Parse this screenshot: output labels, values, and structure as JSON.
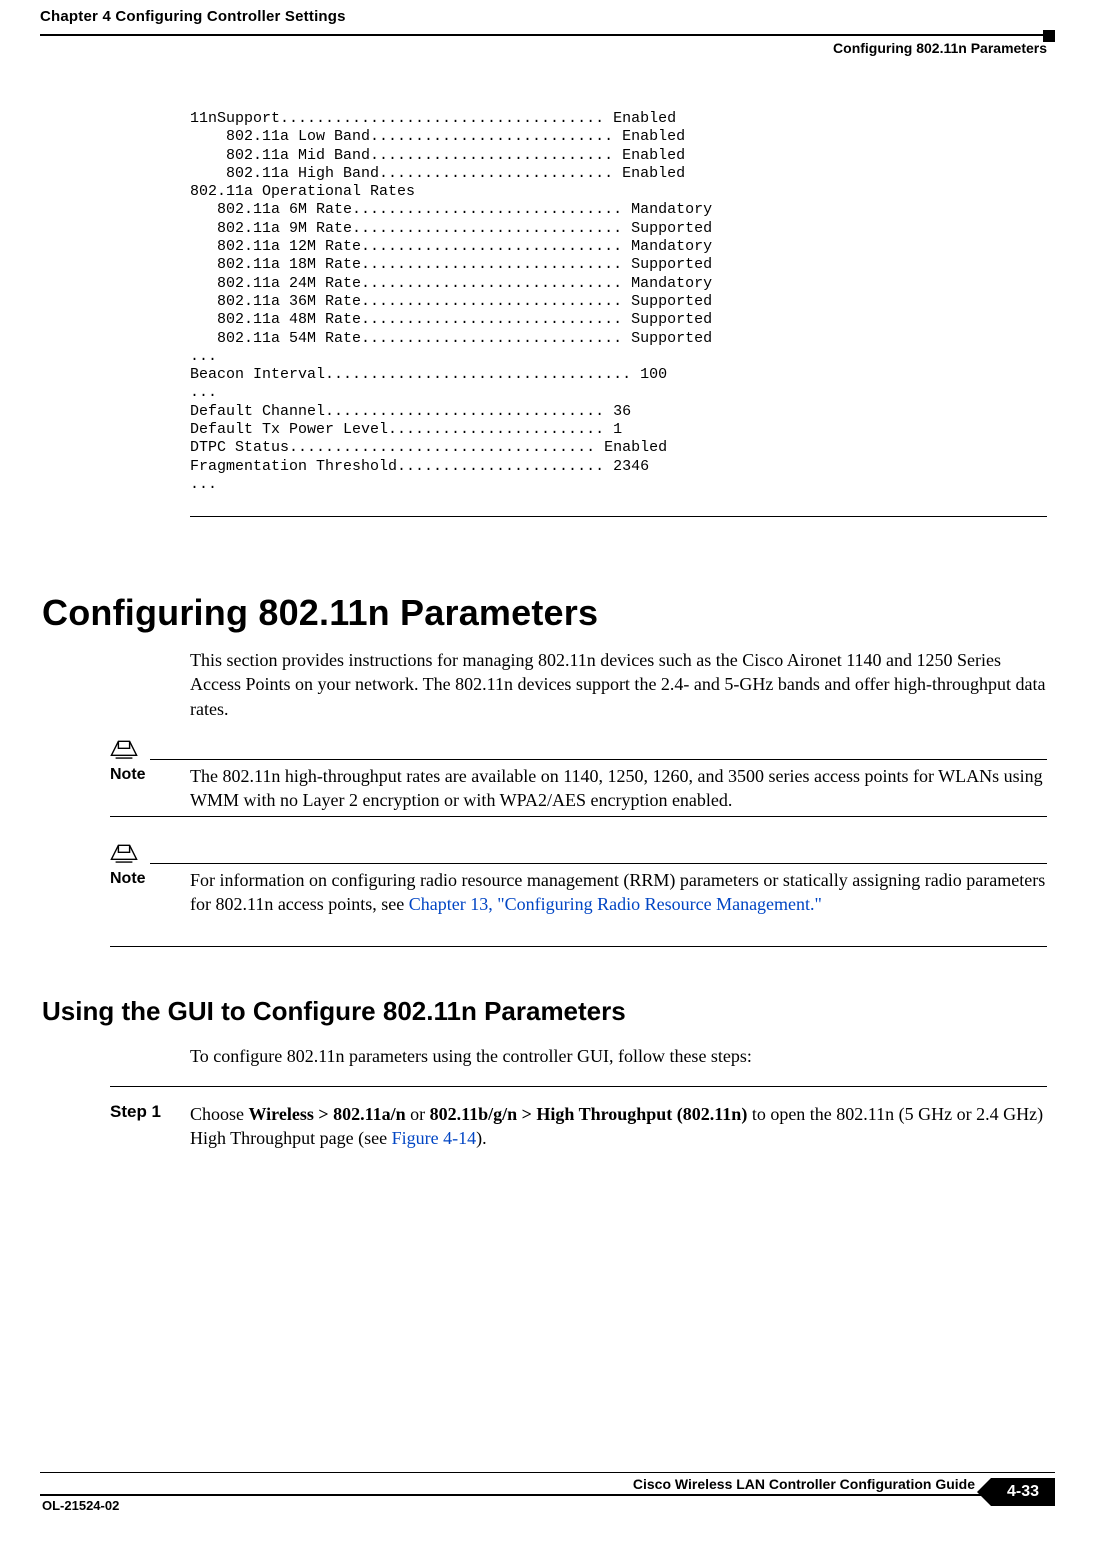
{
  "header": {
    "left": "Chapter 4      Configuring Controller Settings",
    "right": "Configuring 802.11n Parameters"
  },
  "terminal": "11nSupport.................................... Enabled\n    802.11a Low Band........................... Enabled\n    802.11a Mid Band........................... Enabled\n    802.11a High Band.......................... Enabled\n802.11a Operational Rates\n   802.11a 6M Rate.............................. Mandatory\n   802.11a 9M Rate.............................. Supported\n   802.11a 12M Rate............................. Mandatory\n   802.11a 18M Rate............................. Supported\n   802.11a 24M Rate............................. Mandatory\n   802.11a 36M Rate............................. Supported\n   802.11a 48M Rate............................. Supported\n   802.11a 54M Rate............................. Supported\n...\nBeacon Interval.................................. 100\n...\nDefault Channel............................... 36\nDefault Tx Power Level........................ 1\nDTPC Status.................................. Enabled\nFragmentation Threshold....................... 2346\n...",
  "h1": "Configuring 802.11n Parameters",
  "para1": "This section provides instructions for managing 802.11n devices such as the Cisco Aironet 1140 and 1250 Series Access Points on your network. The 802.11n devices support the 2.4- and 5-GHz bands and offer high-throughput data rates.",
  "note1": {
    "label": "Note",
    "text": "The 802.11n high-throughput rates are available on 1140, 1250, 1260, and 3500 series access points for WLANs using WMM with no Layer 2 encryption or with WPA2/AES encryption enabled."
  },
  "note2": {
    "label": "Note",
    "text_pre": "For information on configuring radio resource management (RRM) parameters or statically assigning radio parameters for 802.11n access points, see ",
    "link": "Chapter 13, \"Configuring Radio Resource Management.\""
  },
  "h2": "Using the GUI to Configure 802.11n Parameters",
  "para_h2": "To configure 802.11n parameters using the controller GUI, follow these steps:",
  "step1": {
    "label": "Step 1",
    "pre": "Choose ",
    "b1": "Wireless > 802.11a/n",
    "mid1": " or ",
    "b2": "802.11b/g/n > High Throughput (802.11n)",
    "mid2": " to open the 802.11n (5 GHz or 2.4 GHz) High Throughput page (see ",
    "link": "Figure 4-14",
    "post": ")."
  },
  "footer": {
    "title": "Cisco Wireless LAN Controller Configuration Guide",
    "doc": "OL-21524-02",
    "page": "4-33"
  }
}
